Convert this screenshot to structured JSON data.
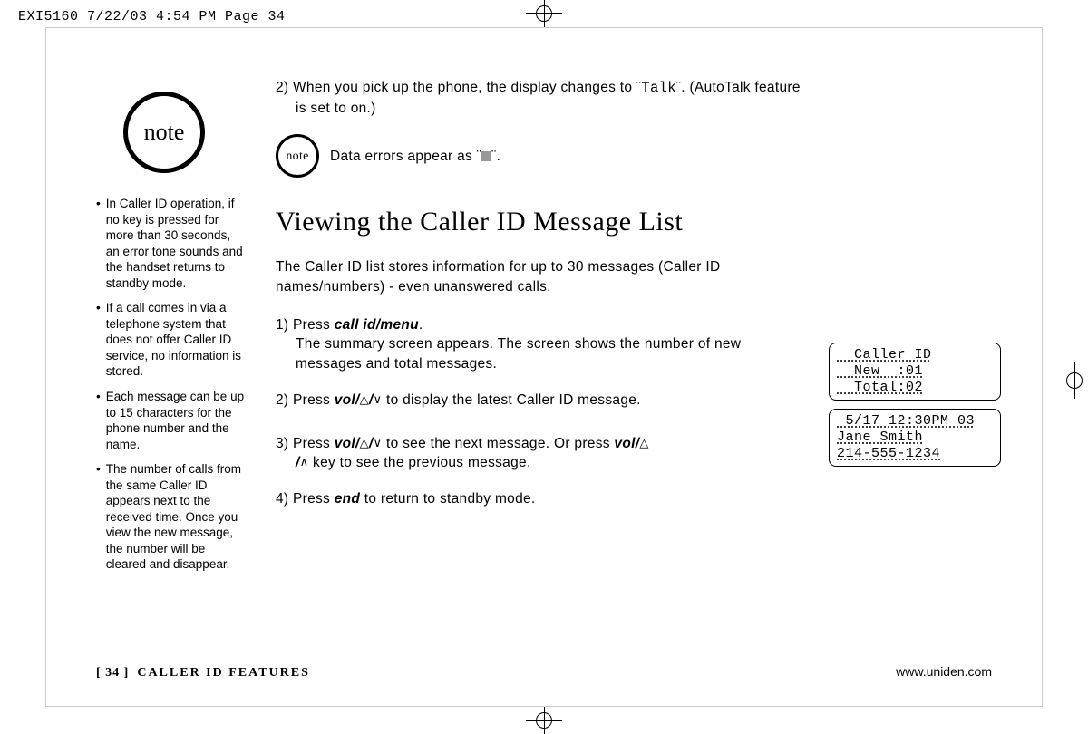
{
  "header": "EXI5160  7/22/03 4:54 PM  Page 34",
  "note_label": "note",
  "sidebar_notes": [
    "In Caller ID operation, if no key is pressed for more than 30 seconds, an error tone sounds and the handset returns to standby mode.",
    "If a call comes in via a telephone system that does not offer Caller ID service, no information is stored.",
    "Each message can be up to 15 characters for the phone number and the name.",
    "The number of calls from the same Caller ID appears next to the received time. Once you view the new message, the number will be cleared and disappear."
  ],
  "step2_top_a": "2) When you pick up the phone, the display changes to ¨",
  "step2_top_talk": "Talk",
  "step2_top_b": "¨. (AutoTalk feature",
  "step2_top_c": "is set to on.)",
  "inline_note_text_a": "Data errors appear as ¨",
  "inline_note_text_b": "¨.",
  "title": "Viewing the Caller ID Message List",
  "intro": "The Caller ID list stores information for up to 30 messages (Caller ID names/numbers) - even unanswered calls.",
  "s1a": "1) Press ",
  "s1_key": "call id/menu",
  "s1b": ".",
  "s1_body": "The summary screen appears. The screen shows the number of new messages and total messages.",
  "s2a": "2) Press ",
  "s2_key": "vol/",
  "s2_slash": "/",
  "s2b": " to display the latest Caller ID message.",
  "s3a": "3) Press ",
  "s3_key": "vol/",
  "s3_mid": " to see the next message. Or press ",
  "s3_body_a": "/",
  "s3_body_b": " key to see the previous message.",
  "s4a": "4) Press ",
  "s4_key": "end",
  "s4b": " to return to standby mode.",
  "lcd1_l1": "  Caller ID",
  "lcd1_l2": "  New  :01",
  "lcd1_l3": "  Total:02",
  "lcd2_l1": " 5/17 12:30PM 03",
  "lcd2_l2": "Jane Smith",
  "lcd2_l3": "214-555-1234",
  "footer_page": "[ 34 ]",
  "footer_section": "CALLER ID FEATURES",
  "footer_url": "www.uniden.com"
}
